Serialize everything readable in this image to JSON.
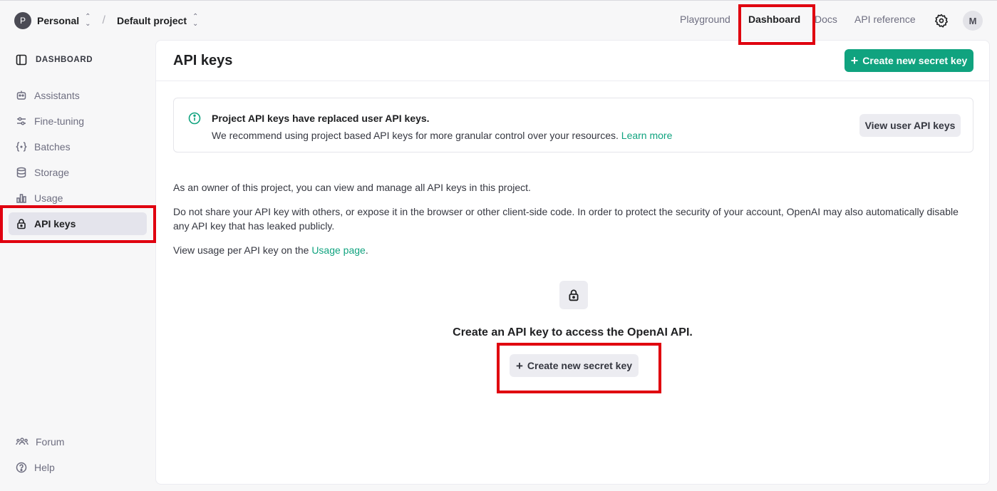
{
  "colors": {
    "accent": "#10a37f",
    "highlight_box": "#e0000f",
    "sidebar_active_bg": "#e4e4ec"
  },
  "topbar": {
    "org": {
      "avatar_letter": "P",
      "name": "Personal"
    },
    "separator": "/",
    "project": {
      "name": "Default project"
    },
    "nav": [
      "Playground",
      "Dashboard",
      "Docs",
      "API reference"
    ],
    "active_nav": "Dashboard",
    "settings_icon": "gear-icon",
    "user_avatar_letter": "M"
  },
  "sidebar": {
    "header": "DASHBOARD",
    "header_icon": "sidebar-toggle-icon",
    "items": [
      {
        "label": "Assistants",
        "icon": "robot-icon"
      },
      {
        "label": "Fine-tuning",
        "icon": "sliders-icon"
      },
      {
        "label": "Batches",
        "icon": "braces-icon"
      },
      {
        "label": "Storage",
        "icon": "database-icon"
      },
      {
        "label": "Usage",
        "icon": "bar-chart-icon"
      },
      {
        "label": "API keys",
        "icon": "lock-icon",
        "active": true
      }
    ],
    "footer_items": [
      {
        "label": "Forum",
        "icon": "people-icon"
      },
      {
        "label": "Help",
        "icon": "question-icon"
      }
    ]
  },
  "main": {
    "title": "API keys",
    "create_button_label": "Create new secret key",
    "banner": {
      "icon": "info-icon",
      "title": "Project API keys have replaced user API keys.",
      "text": "We recommend using project based API keys for more granular control over your resources.",
      "link": "Learn more",
      "button_label": "View user API keys"
    },
    "paragraphs": {
      "p1": "As an owner of this project, you can view and manage all API keys in this project.",
      "p2": "Do not share your API key with others, or expose it in the browser or other client-side code. In order to protect the security of your account, OpenAI may also automatically disable any API key that has leaked publicly.",
      "p3_prefix": "View usage per API key on the",
      "p3_link": "Usage page",
      "p3_suffix": "."
    },
    "empty_state": {
      "icon": "lock-icon",
      "title": "Create an API key to access the OpenAI API.",
      "button_label": "Create new secret key"
    }
  }
}
